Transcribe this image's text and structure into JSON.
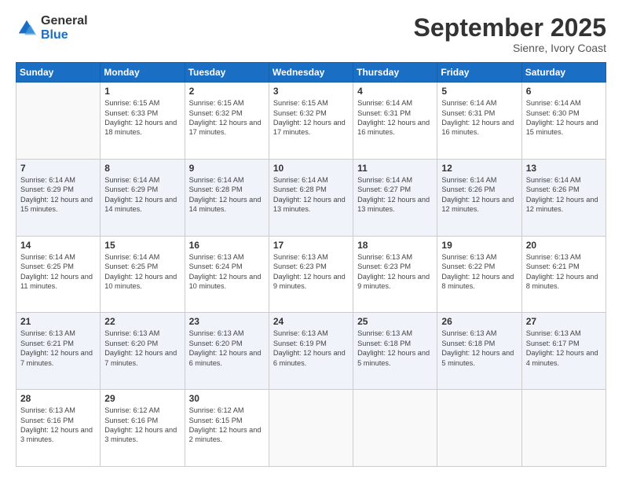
{
  "logo": {
    "general": "General",
    "blue": "Blue"
  },
  "header": {
    "month": "September 2025",
    "location": "Sienre, Ivory Coast"
  },
  "weekdays": [
    "Sunday",
    "Monday",
    "Tuesday",
    "Wednesday",
    "Thursday",
    "Friday",
    "Saturday"
  ],
  "weeks": [
    [
      {
        "day": "",
        "sunrise": "",
        "sunset": "",
        "daylight": ""
      },
      {
        "day": "1",
        "sunrise": "Sunrise: 6:15 AM",
        "sunset": "Sunset: 6:33 PM",
        "daylight": "Daylight: 12 hours and 18 minutes."
      },
      {
        "day": "2",
        "sunrise": "Sunrise: 6:15 AM",
        "sunset": "Sunset: 6:32 PM",
        "daylight": "Daylight: 12 hours and 17 minutes."
      },
      {
        "day": "3",
        "sunrise": "Sunrise: 6:15 AM",
        "sunset": "Sunset: 6:32 PM",
        "daylight": "Daylight: 12 hours and 17 minutes."
      },
      {
        "day": "4",
        "sunrise": "Sunrise: 6:14 AM",
        "sunset": "Sunset: 6:31 PM",
        "daylight": "Daylight: 12 hours and 16 minutes."
      },
      {
        "day": "5",
        "sunrise": "Sunrise: 6:14 AM",
        "sunset": "Sunset: 6:31 PM",
        "daylight": "Daylight: 12 hours and 16 minutes."
      },
      {
        "day": "6",
        "sunrise": "Sunrise: 6:14 AM",
        "sunset": "Sunset: 6:30 PM",
        "daylight": "Daylight: 12 hours and 15 minutes."
      }
    ],
    [
      {
        "day": "7",
        "sunrise": "Sunrise: 6:14 AM",
        "sunset": "Sunset: 6:29 PM",
        "daylight": "Daylight: 12 hours and 15 minutes."
      },
      {
        "day": "8",
        "sunrise": "Sunrise: 6:14 AM",
        "sunset": "Sunset: 6:29 PM",
        "daylight": "Daylight: 12 hours and 14 minutes."
      },
      {
        "day": "9",
        "sunrise": "Sunrise: 6:14 AM",
        "sunset": "Sunset: 6:28 PM",
        "daylight": "Daylight: 12 hours and 14 minutes."
      },
      {
        "day": "10",
        "sunrise": "Sunrise: 6:14 AM",
        "sunset": "Sunset: 6:28 PM",
        "daylight": "Daylight: 12 hours and 13 minutes."
      },
      {
        "day": "11",
        "sunrise": "Sunrise: 6:14 AM",
        "sunset": "Sunset: 6:27 PM",
        "daylight": "Daylight: 12 hours and 13 minutes."
      },
      {
        "day": "12",
        "sunrise": "Sunrise: 6:14 AM",
        "sunset": "Sunset: 6:26 PM",
        "daylight": "Daylight: 12 hours and 12 minutes."
      },
      {
        "day": "13",
        "sunrise": "Sunrise: 6:14 AM",
        "sunset": "Sunset: 6:26 PM",
        "daylight": "Daylight: 12 hours and 12 minutes."
      }
    ],
    [
      {
        "day": "14",
        "sunrise": "Sunrise: 6:14 AM",
        "sunset": "Sunset: 6:25 PM",
        "daylight": "Daylight: 12 hours and 11 minutes."
      },
      {
        "day": "15",
        "sunrise": "Sunrise: 6:14 AM",
        "sunset": "Sunset: 6:25 PM",
        "daylight": "Daylight: 12 hours and 10 minutes."
      },
      {
        "day": "16",
        "sunrise": "Sunrise: 6:13 AM",
        "sunset": "Sunset: 6:24 PM",
        "daylight": "Daylight: 12 hours and 10 minutes."
      },
      {
        "day": "17",
        "sunrise": "Sunrise: 6:13 AM",
        "sunset": "Sunset: 6:23 PM",
        "daylight": "Daylight: 12 hours and 9 minutes."
      },
      {
        "day": "18",
        "sunrise": "Sunrise: 6:13 AM",
        "sunset": "Sunset: 6:23 PM",
        "daylight": "Daylight: 12 hours and 9 minutes."
      },
      {
        "day": "19",
        "sunrise": "Sunrise: 6:13 AM",
        "sunset": "Sunset: 6:22 PM",
        "daylight": "Daylight: 12 hours and 8 minutes."
      },
      {
        "day": "20",
        "sunrise": "Sunrise: 6:13 AM",
        "sunset": "Sunset: 6:21 PM",
        "daylight": "Daylight: 12 hours and 8 minutes."
      }
    ],
    [
      {
        "day": "21",
        "sunrise": "Sunrise: 6:13 AM",
        "sunset": "Sunset: 6:21 PM",
        "daylight": "Daylight: 12 hours and 7 minutes."
      },
      {
        "day": "22",
        "sunrise": "Sunrise: 6:13 AM",
        "sunset": "Sunset: 6:20 PM",
        "daylight": "Daylight: 12 hours and 7 minutes."
      },
      {
        "day": "23",
        "sunrise": "Sunrise: 6:13 AM",
        "sunset": "Sunset: 6:20 PM",
        "daylight": "Daylight: 12 hours and 6 minutes."
      },
      {
        "day": "24",
        "sunrise": "Sunrise: 6:13 AM",
        "sunset": "Sunset: 6:19 PM",
        "daylight": "Daylight: 12 hours and 6 minutes."
      },
      {
        "day": "25",
        "sunrise": "Sunrise: 6:13 AM",
        "sunset": "Sunset: 6:18 PM",
        "daylight": "Daylight: 12 hours and 5 minutes."
      },
      {
        "day": "26",
        "sunrise": "Sunrise: 6:13 AM",
        "sunset": "Sunset: 6:18 PM",
        "daylight": "Daylight: 12 hours and 5 minutes."
      },
      {
        "day": "27",
        "sunrise": "Sunrise: 6:13 AM",
        "sunset": "Sunset: 6:17 PM",
        "daylight": "Daylight: 12 hours and 4 minutes."
      }
    ],
    [
      {
        "day": "28",
        "sunrise": "Sunrise: 6:13 AM",
        "sunset": "Sunset: 6:16 PM",
        "daylight": "Daylight: 12 hours and 3 minutes."
      },
      {
        "day": "29",
        "sunrise": "Sunrise: 6:12 AM",
        "sunset": "Sunset: 6:16 PM",
        "daylight": "Daylight: 12 hours and 3 minutes."
      },
      {
        "day": "30",
        "sunrise": "Sunrise: 6:12 AM",
        "sunset": "Sunset: 6:15 PM",
        "daylight": "Daylight: 12 hours and 2 minutes."
      },
      {
        "day": "",
        "sunrise": "",
        "sunset": "",
        "daylight": ""
      },
      {
        "day": "",
        "sunrise": "",
        "sunset": "",
        "daylight": ""
      },
      {
        "day": "",
        "sunrise": "",
        "sunset": "",
        "daylight": ""
      },
      {
        "day": "",
        "sunrise": "",
        "sunset": "",
        "daylight": ""
      }
    ]
  ]
}
